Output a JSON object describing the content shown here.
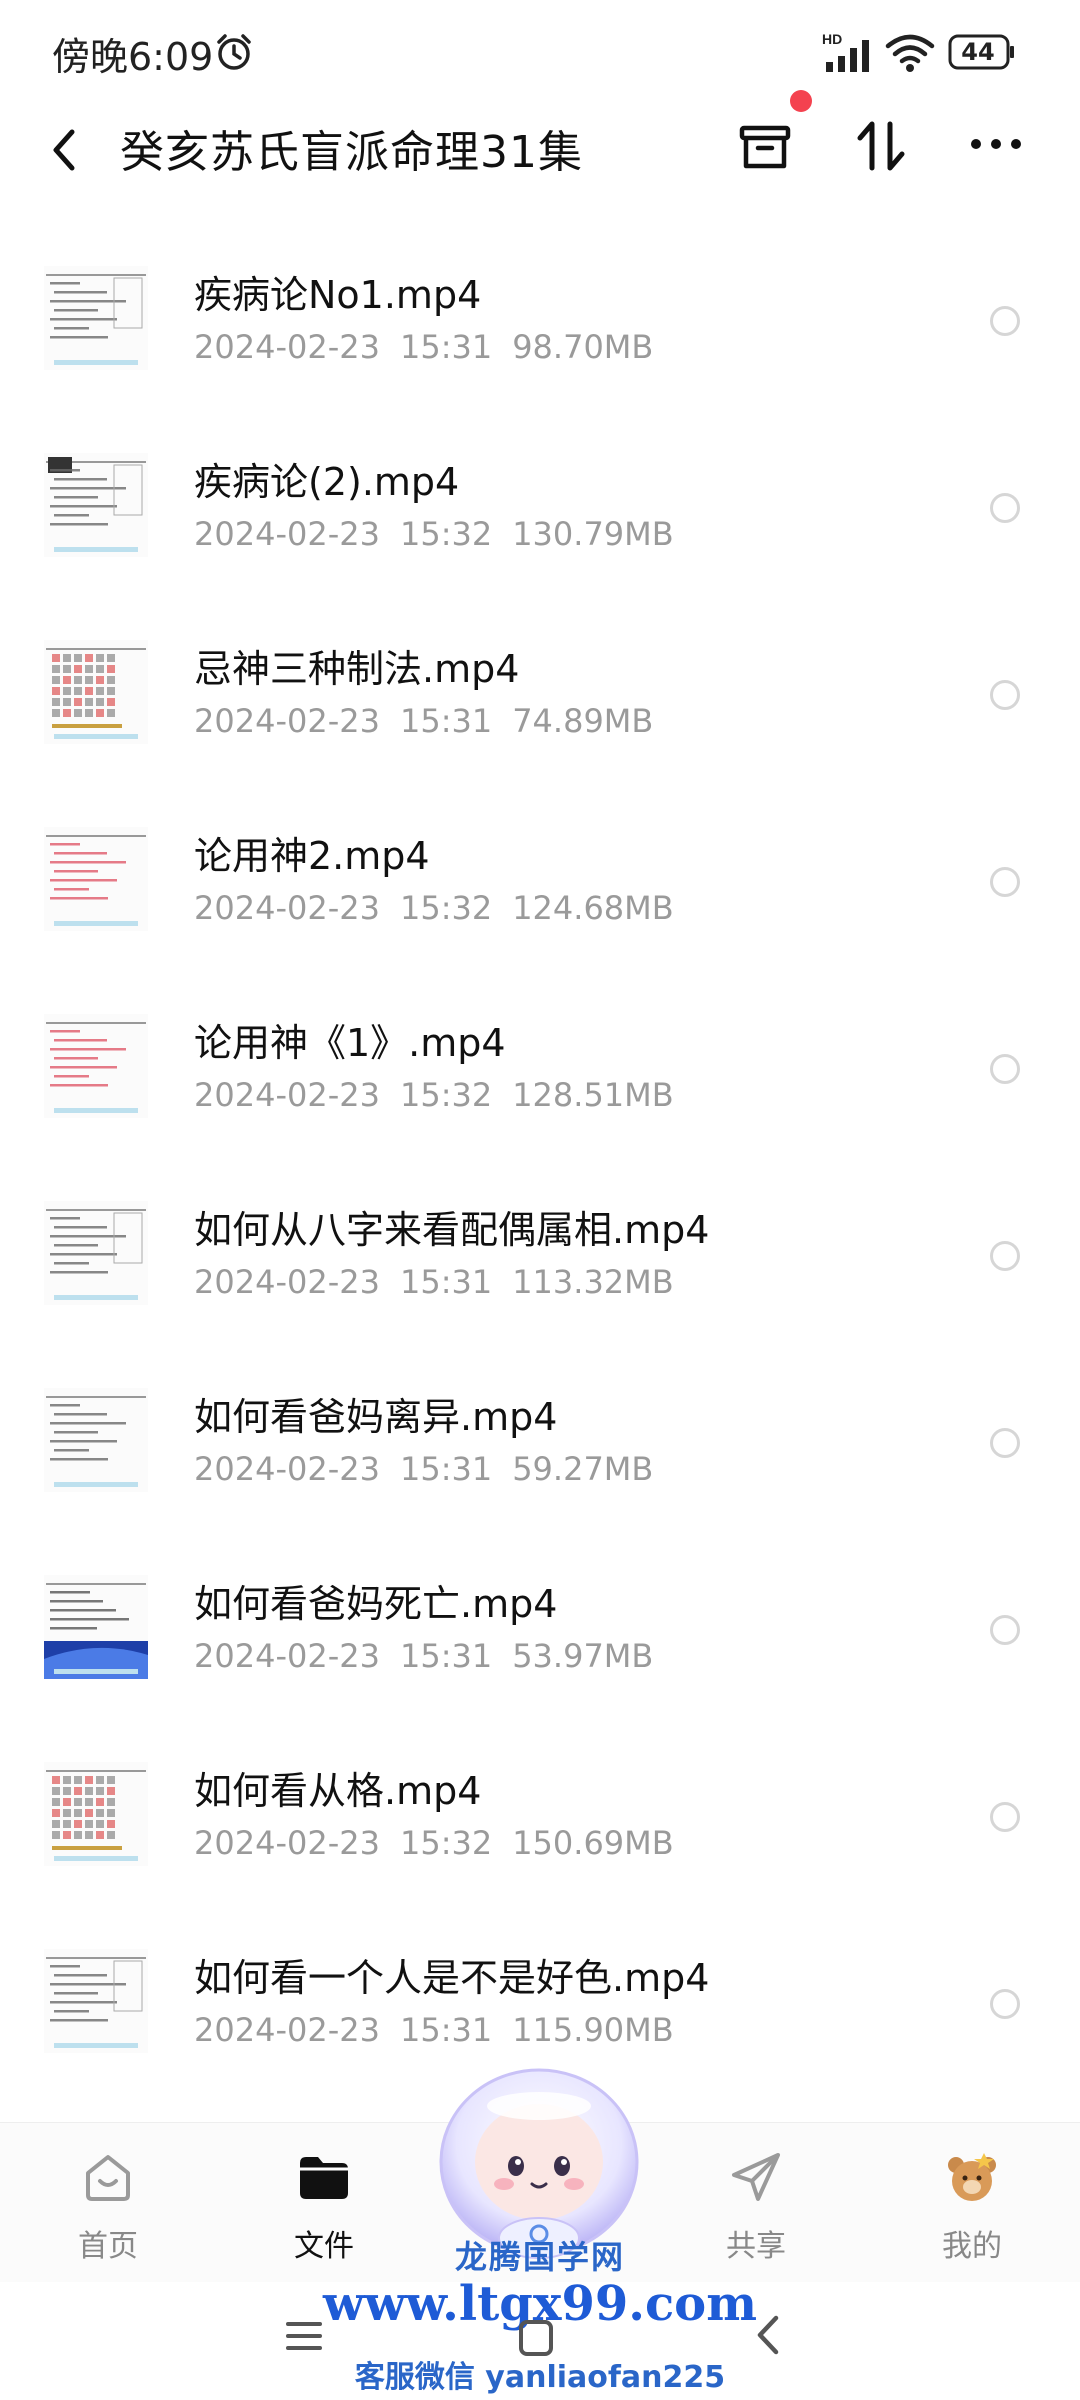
{
  "status_bar": {
    "time": "傍晚6:09",
    "network_label": "HD",
    "battery": "44"
  },
  "header": {
    "title": "癸亥苏氏盲派命理31集"
  },
  "files": [
    {
      "name": "疾病论No1.mp4",
      "date": "2024-02-23",
      "time": "15:31",
      "size": "98.70MB",
      "thumb": "table"
    },
    {
      "name": "疾病论(2).mp4",
      "date": "2024-02-23",
      "time": "15:32",
      "size": "130.79MB",
      "thumb": "table-dark"
    },
    {
      "name": "忌神三种制法.mp4",
      "date": "2024-02-23",
      "time": "15:31",
      "size": "74.89MB",
      "thumb": "grid-red"
    },
    {
      "name": "论用神2.mp4",
      "date": "2024-02-23",
      "time": "15:32",
      "size": "124.68MB",
      "thumb": "text-red"
    },
    {
      "name": "论用神《1》.mp4",
      "date": "2024-02-23",
      "time": "15:32",
      "size": "128.51MB",
      "thumb": "text-red"
    },
    {
      "name": "如何从八字来看配偶属相.mp4",
      "date": "2024-02-23",
      "time": "15:31",
      "size": "113.32MB",
      "thumb": "table"
    },
    {
      "name": "如何看爸妈离异.mp4",
      "date": "2024-02-23",
      "time": "15:31",
      "size": "59.27MB",
      "thumb": "text"
    },
    {
      "name": "如何看爸妈死亡.mp4",
      "date": "2024-02-23",
      "time": "15:31",
      "size": "53.97MB",
      "thumb": "blue"
    },
    {
      "name": "如何看从格.mp4",
      "date": "2024-02-23",
      "time": "15:32",
      "size": "150.69MB",
      "thumb": "grid-red"
    },
    {
      "name": "如何看一个人是不是好色.mp4",
      "date": "2024-02-23",
      "time": "15:31",
      "size": "115.90MB",
      "thumb": "table"
    }
  ],
  "bottom_nav": {
    "items": [
      {
        "label": "首页",
        "icon": "home-icon"
      },
      {
        "label": "文件",
        "icon": "folder-icon",
        "active": true
      },
      {
        "label": "共享",
        "icon": "share-plane-icon"
      },
      {
        "label": "我的",
        "icon": "bear-avatar-icon"
      }
    ]
  },
  "watermark": {
    "title": "龙腾国学网",
    "url": "www.ltgx99.com",
    "contact": "客服微信 yanliaofan225"
  },
  "colors": {
    "accent_dot": "#f4424f",
    "watermark_blue": "#1e5bd6",
    "meta_gray": "#9a9a9a"
  }
}
